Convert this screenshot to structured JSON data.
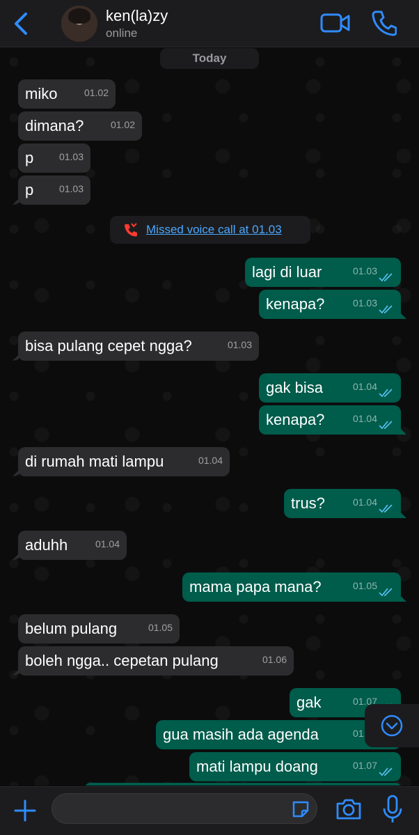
{
  "header": {
    "contact_name": "ken(la)zy",
    "status": "online"
  },
  "chat": {
    "date_chip": "Today",
    "missed_call": "Missed voice call at 01.03",
    "messages": [
      {
        "dir": "in",
        "text": "miko",
        "time": "01.02"
      },
      {
        "dir": "in",
        "text": "dimana?",
        "time": "01.02"
      },
      {
        "dir": "in",
        "text": "p",
        "time": "01.03"
      },
      {
        "dir": "in",
        "text": "p",
        "time": "01.03"
      },
      {
        "dir": "out",
        "text": "lagi di luar",
        "time": "01.03"
      },
      {
        "dir": "out",
        "text": "kenapa?",
        "time": "01.03"
      },
      {
        "dir": "in",
        "text": "bisa pulang cepet ngga?",
        "time": "01.03"
      },
      {
        "dir": "out",
        "text": "gak bisa",
        "time": "01.04"
      },
      {
        "dir": "out",
        "text": "kenapa?",
        "time": "01.04"
      },
      {
        "dir": "in",
        "text": "di rumah mati lampu",
        "time": "01.04"
      },
      {
        "dir": "out",
        "text": "trus?",
        "time": "01.04"
      },
      {
        "dir": "in",
        "text": "aduhh",
        "time": "01.04"
      },
      {
        "dir": "out",
        "text": "mama papa mana?",
        "time": "01.05"
      },
      {
        "dir": "in",
        "text": "belum pulang",
        "time": "01.05"
      },
      {
        "dir": "in",
        "text": "boleh ngga.. cepetan pulang",
        "time": "01.06"
      },
      {
        "dir": "out",
        "text": "gak",
        "time": "01.07"
      },
      {
        "dir": "out",
        "text": "gua masih ada agenda",
        "time": "01.07"
      },
      {
        "dir": "out",
        "text": "mati lampu doang",
        "time": "01.07"
      }
    ]
  },
  "input": {
    "message_value": "",
    "message_placeholder": ""
  },
  "colors": {
    "incoming_bubble": "#2c2c2e",
    "outgoing_bubble": "#005c4b",
    "accent_blue": "#2f8cff",
    "read_ticks": "#53bdeb",
    "missed_call_red": "#ff3b30"
  },
  "icons": [
    "back-chevron-icon",
    "video-call-icon",
    "phone-icon",
    "missed-call-icon",
    "double-check-icon",
    "chevron-down-icon",
    "plus-icon",
    "sticker-icon",
    "camera-icon",
    "microphone-icon"
  ]
}
